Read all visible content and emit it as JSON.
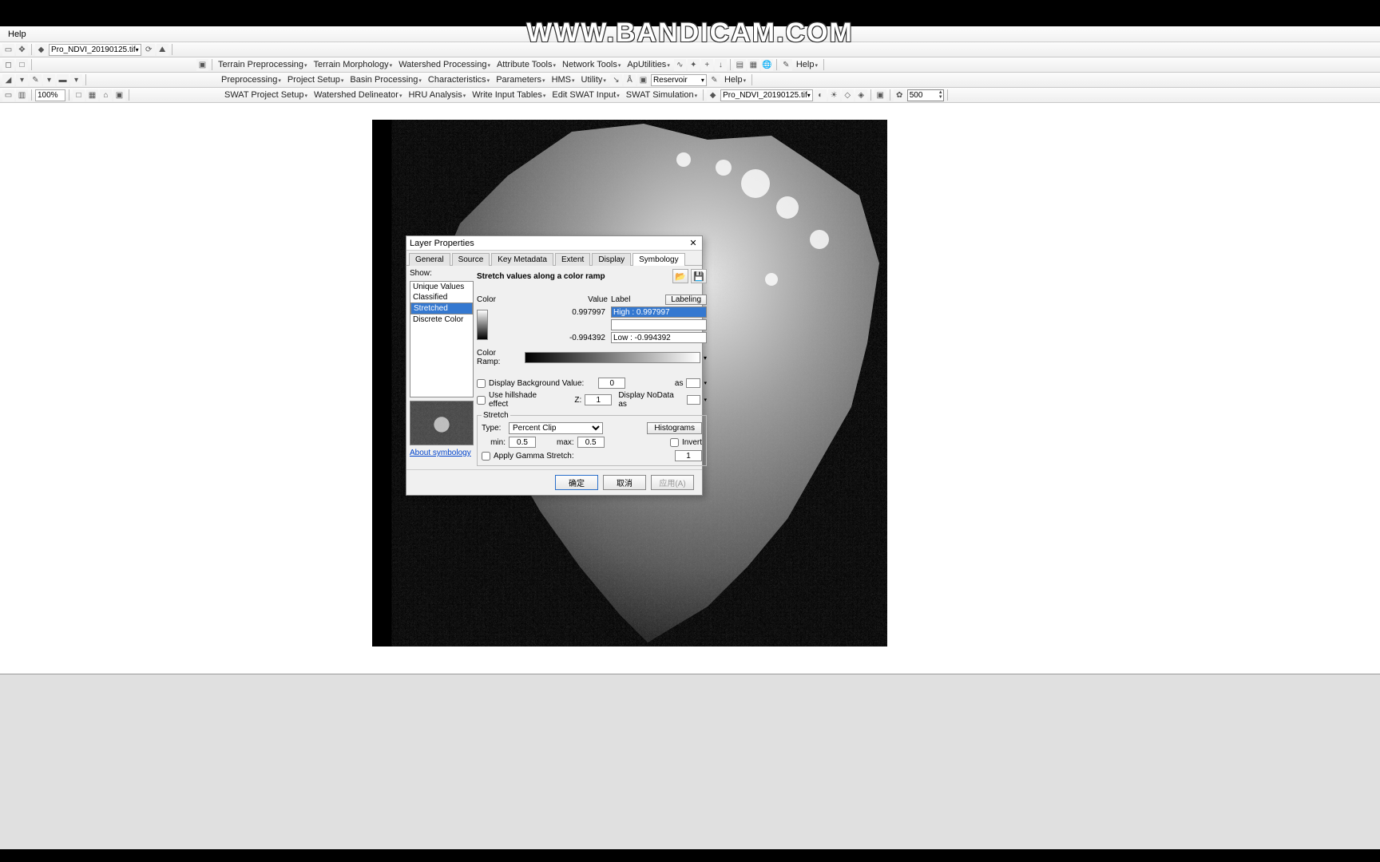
{
  "watermark": "WWW.BANDICAM.COM",
  "menubar": {
    "help": "Help"
  },
  "tb1": {
    "layer_combo": "Pro_NDVI_20190125.tif"
  },
  "tb2": {
    "terrain_pre": "Terrain Preprocessing",
    "terrain_morph": "Terrain Morphology",
    "watershed_proc": "Watershed Processing",
    "attr_tools": "Attribute Tools",
    "net_tools": "Network Tools",
    "aputil": "ApUtilities",
    "help": "Help"
  },
  "tb3": {
    "preproc": "Preprocessing",
    "project_setup": "Project Setup",
    "basin_proc": "Basin Processing",
    "charact": "Characteristics",
    "params": "Parameters",
    "hms": "HMS",
    "utility": "Utility",
    "reservoir": "Reservoir",
    "help": "Help"
  },
  "tb4": {
    "swat_proj": "SWAT Project Setup",
    "watershed_del": "Watershed Delineator",
    "hru": "HRU Analysis",
    "write_input": "Write Input Tables",
    "edit_swat": "Edit SWAT Input",
    "swat_sim": "SWAT Simulation",
    "layer_combo2": "Pro_NDVI_20190125.tif",
    "spin": "500"
  },
  "tb5": {
    "zoom": "100%"
  },
  "dialog": {
    "title": "Layer Properties",
    "tabs": {
      "general": "General",
      "source": "Source",
      "keymeta": "Key Metadata",
      "extent": "Extent",
      "display": "Display",
      "symbology": "Symbology"
    },
    "show_label": "Show:",
    "show_items": {
      "unique": "Unique Values",
      "classified": "Classified",
      "stretched": "Stretched",
      "discrete": "Discrete Color"
    },
    "about": "About symbology",
    "header": "Stretch values along a color ramp",
    "grid": {
      "color": "Color",
      "value": "Value",
      "label": "Label",
      "labeling_btn": "Labeling",
      "high_val": "0.997997",
      "high_label": "High : 0.997997",
      "low_val": "-0.994392",
      "low_label": "Low : -0.994392"
    },
    "colorramp_label": "Color Ramp:",
    "bg": {
      "check": "Display Background Value:",
      "val": "0",
      "as": "as"
    },
    "hill": {
      "check": "Use hillshade effect",
      "z": "Z:",
      "zval": "1",
      "nodata": "Display NoData as"
    },
    "stretch": {
      "legend": "Stretch",
      "type_lbl": "Type:",
      "type_val": "Percent Clip",
      "histograms": "Histograms",
      "min_lbl": "min:",
      "min_val": "0.5",
      "max_lbl": "max:",
      "max_val": "0.5",
      "invert": "Invert",
      "gamma": "Apply Gamma Stretch:",
      "gamma_val": "1"
    },
    "buttons": {
      "ok": "确定",
      "cancel": "取消",
      "apply": "应用(A)"
    }
  }
}
